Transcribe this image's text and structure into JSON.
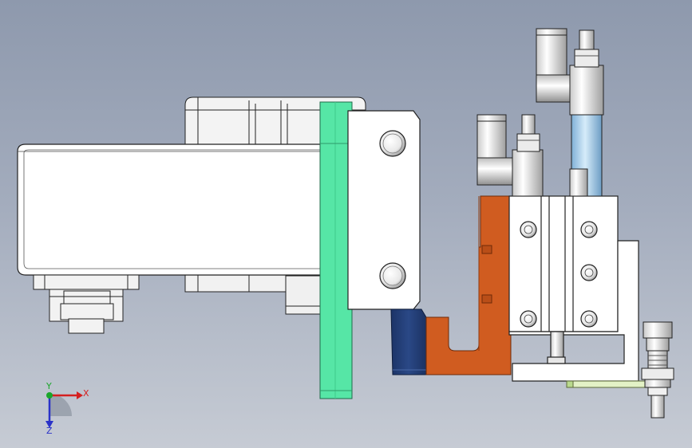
{
  "viewport": {
    "background_top": "#8e99ad",
    "background_bottom": "#c6cbd4"
  },
  "model": {
    "description_visible": false,
    "parts": [
      {
        "name": "motor-body",
        "color": "#ffffff"
      },
      {
        "name": "mounting-plate-green",
        "color": "#4fe3a2"
      },
      {
        "name": "bracket-navy",
        "color": "#24407a"
      },
      {
        "name": "bracket-orange",
        "color": "#cc5a1f"
      },
      {
        "name": "air-tube-blue",
        "color": "#a9cce8"
      },
      {
        "name": "shaft-guide-lime",
        "color": "#e2f2c4"
      }
    ]
  },
  "triad": {
    "x_label": "X",
    "y_label": "Y",
    "z_label": "Z",
    "x_color": "#d42020",
    "y_color": "#1aa62a",
    "z_color": "#2a32c8"
  }
}
